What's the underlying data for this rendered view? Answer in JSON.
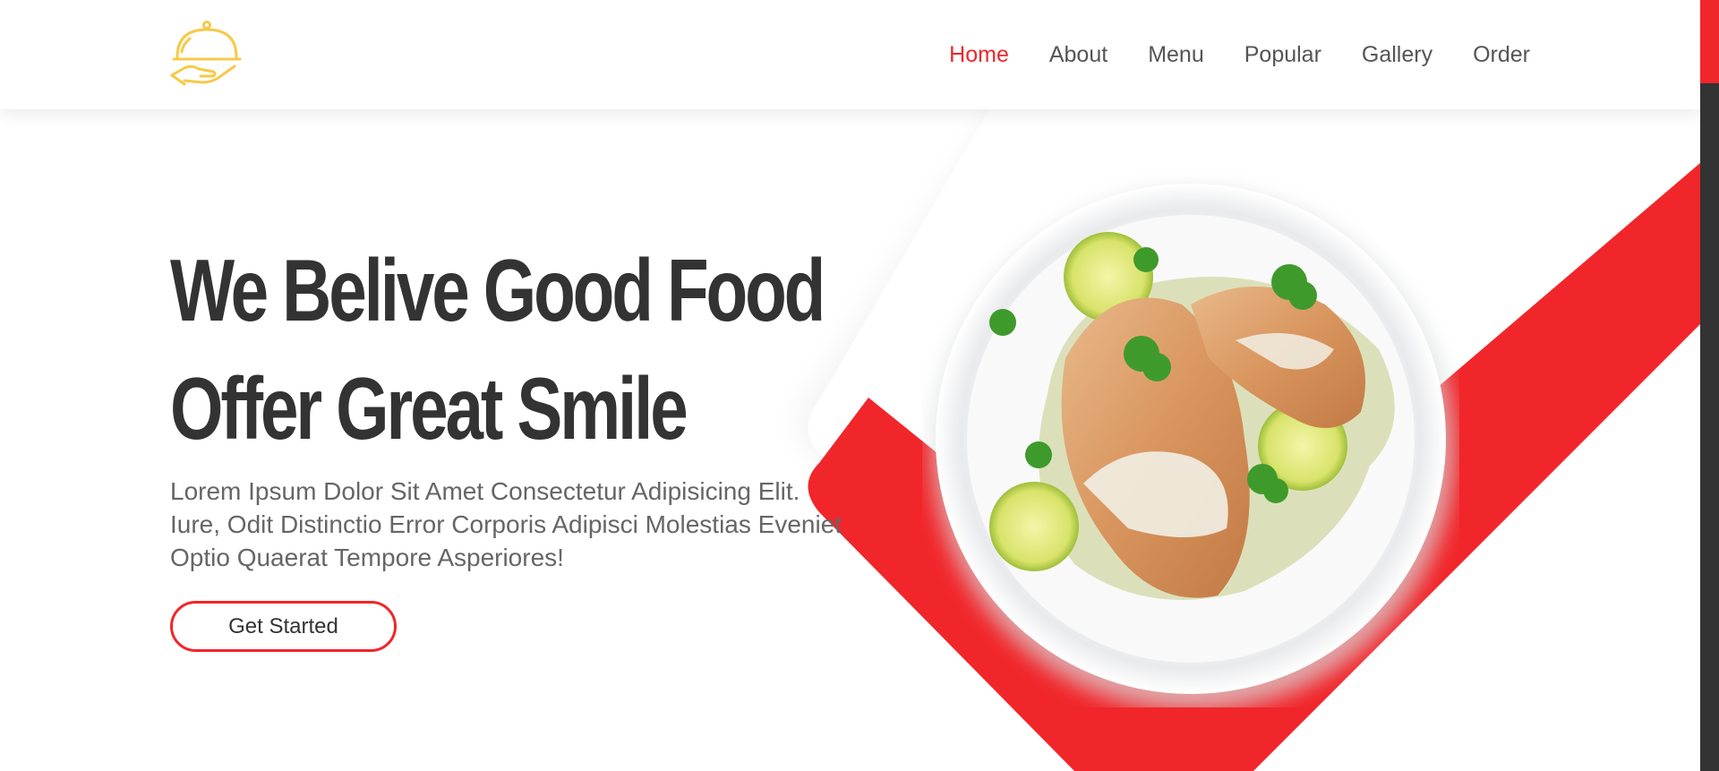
{
  "header": {
    "logo_icon": "serving-cloche-icon",
    "nav": [
      {
        "label": "Home",
        "active": true
      },
      {
        "label": "About",
        "active": false
      },
      {
        "label": "Menu",
        "active": false
      },
      {
        "label": "Popular",
        "active": false
      },
      {
        "label": "Gallery",
        "active": false
      },
      {
        "label": "Order",
        "active": false
      }
    ]
  },
  "hero": {
    "title_line1": "We Belive Good Food",
    "title_line2": "Offer Great Smile",
    "description": "Lorem Ipsum Dolor Sit Amet Consectetur Adipisicing Elit. Iure, Odit Distinctio Error Corporis Adipisci Molestias Eveniet Optio Quaerat Tempore Asperiores!",
    "cta_label": "Get Started",
    "image_subject": "grilled-chicken-plate"
  },
  "colors": {
    "accent": "#f1262a",
    "logo": "#f7c948",
    "heading": "#333333",
    "text": "#666666",
    "scrollbar_track": "#333333"
  }
}
